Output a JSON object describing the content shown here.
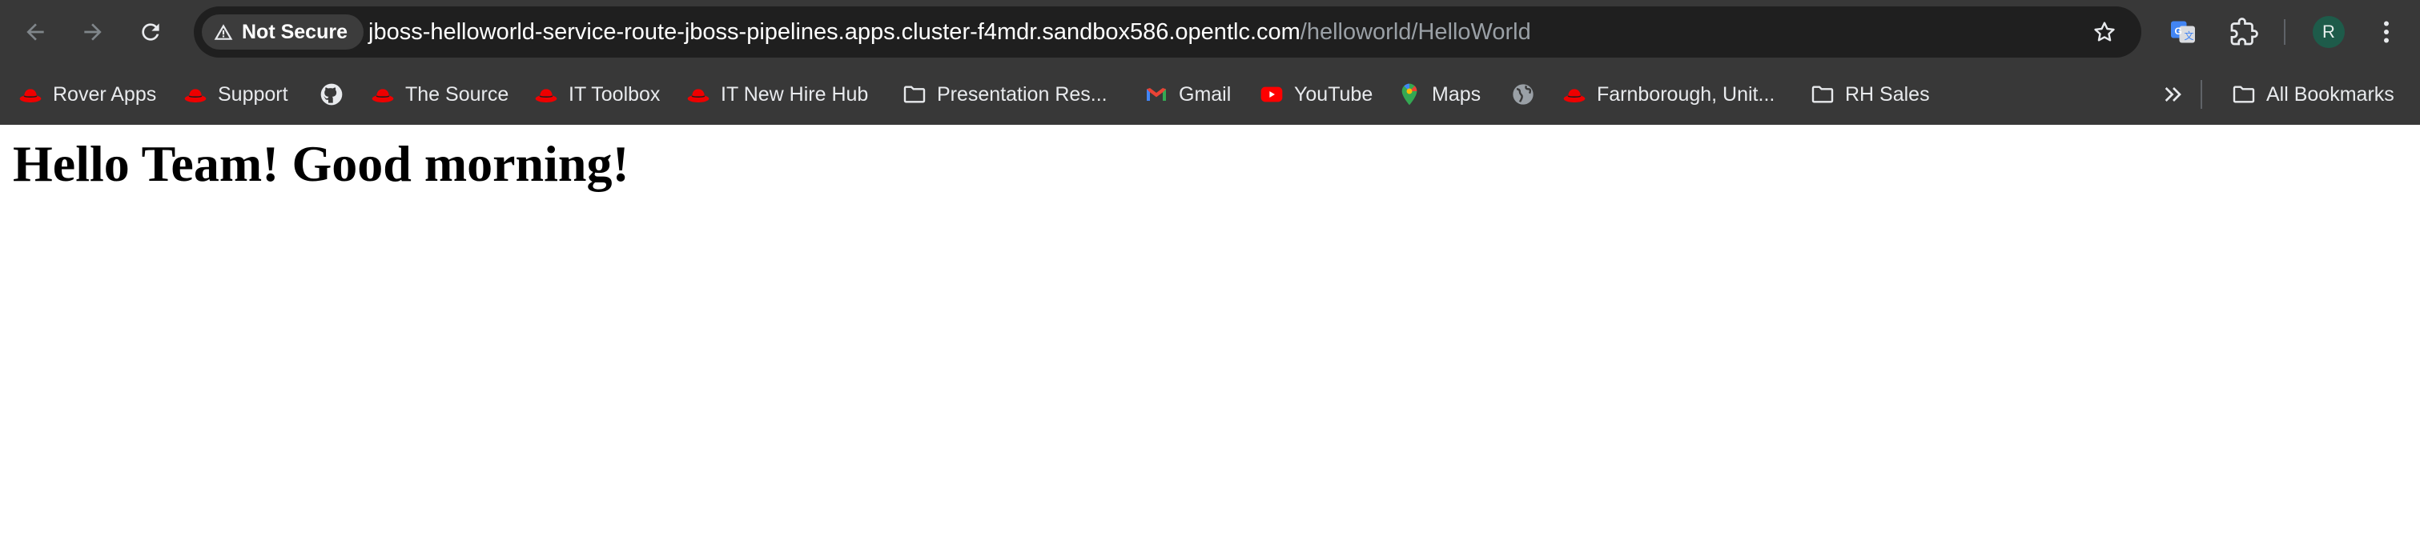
{
  "toolbar": {
    "back_icon": "arrow-left-icon",
    "forward_icon": "arrow-right-icon",
    "reload_icon": "reload-icon",
    "security": {
      "label": "Not Secure",
      "icon": "warning-triangle-icon"
    },
    "url": {
      "host": "jboss-helloworld-service-route-jboss-pipelines.apps.cluster-f4mdr.sandbox586.opentlc.com",
      "path": "/helloworld/HelloWorld"
    },
    "bookmark_star_icon": "star-icon",
    "extensions": [
      "google-translate-icon",
      "puzzle-extensions-icon"
    ],
    "profile_initial": "R",
    "menu_icon": "kebab-menu-icon"
  },
  "bookmarks": {
    "items": [
      {
        "label": "Rover Apps",
        "icon": "redhat-icon"
      },
      {
        "label": "Support",
        "icon": "redhat-icon"
      },
      {
        "label": "",
        "icon": "github-icon"
      },
      {
        "label": "The Source",
        "icon": "redhat-icon"
      },
      {
        "label": "IT Toolbox",
        "icon": "redhat-icon"
      },
      {
        "label": "IT New Hire Hub",
        "icon": "redhat-icon"
      },
      {
        "label": "Presentation Res...",
        "icon": "folder-icon"
      },
      {
        "label": "Gmail",
        "icon": "gmail-icon"
      },
      {
        "label": "YouTube",
        "icon": "youtube-icon"
      },
      {
        "label": "Maps",
        "icon": "maps-pin-icon"
      },
      {
        "label": "",
        "icon": "globe-icon"
      },
      {
        "label": "Farnborough, Unit...",
        "icon": "redhat-icon"
      },
      {
        "label": "RH Sales",
        "icon": "folder-icon"
      }
    ],
    "overflow_icon": "double-chevron-icon",
    "all_bookmarks": {
      "label": "All Bookmarks",
      "icon": "folder-icon"
    }
  },
  "page": {
    "heading": "Hello Team! Good morning!"
  },
  "colors": {
    "chrome_dark": "#383838",
    "omnibox": "#1f1f1f",
    "redhat_red": "#ee0000",
    "avatar_bg": "#1e5b4a"
  }
}
